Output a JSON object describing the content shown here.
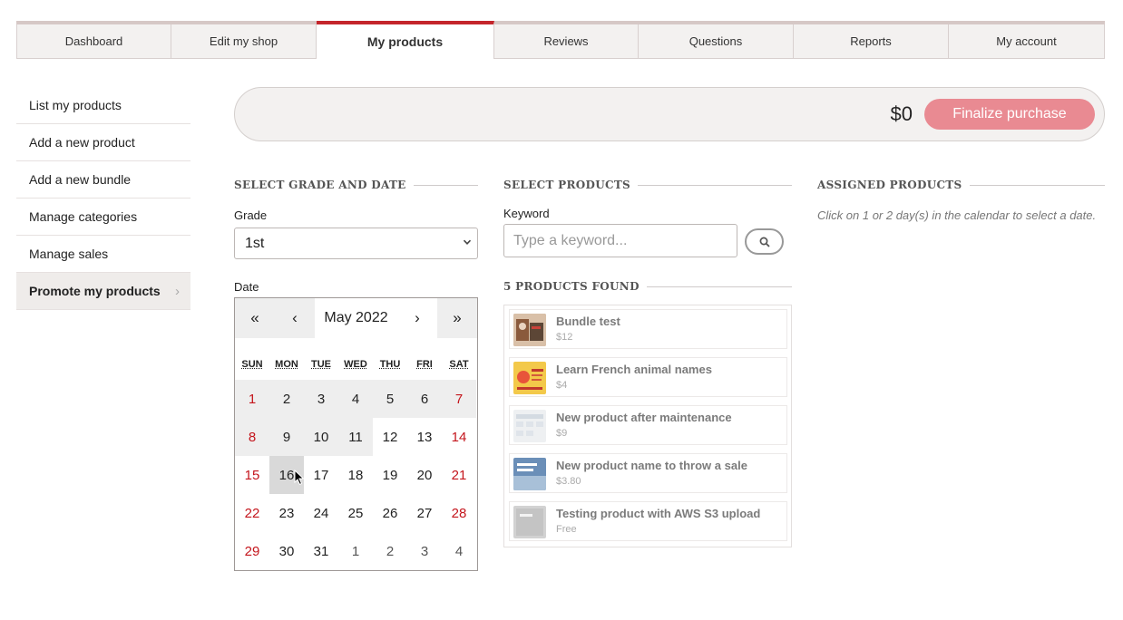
{
  "tabs": [
    {
      "label": "Dashboard"
    },
    {
      "label": "Edit my shop"
    },
    {
      "label": "My products",
      "active": true
    },
    {
      "label": "Reviews"
    },
    {
      "label": "Questions"
    },
    {
      "label": "Reports"
    },
    {
      "label": "My account"
    }
  ],
  "sidebar": {
    "items": [
      {
        "label": "List my products"
      },
      {
        "label": "Add a new product"
      },
      {
        "label": "Add a new bundle"
      },
      {
        "label": "Manage categories"
      },
      {
        "label": "Manage sales"
      },
      {
        "label": "Promote my products",
        "active": true,
        "chevron": "›"
      }
    ]
  },
  "purchase": {
    "total": "$0",
    "button": "Finalize purchase"
  },
  "grade_date": {
    "heading": "SELECT GRADE AND DATE",
    "grade_label": "Grade",
    "grade_value": "1st",
    "date_label": "Date"
  },
  "calendar": {
    "prev_year": "«",
    "prev_month": "‹",
    "month": "May 2022",
    "next_month": "›",
    "next_year": "»",
    "days_of_week": [
      "SUN",
      "MON",
      "TUE",
      "WED",
      "THU",
      "FRI",
      "SAT"
    ],
    "weeks": [
      [
        "1",
        "2",
        "3",
        "4",
        "5",
        "6",
        "7"
      ],
      [
        "8",
        "9",
        "10",
        "11",
        "12",
        "13",
        "14"
      ],
      [
        "15",
        "16",
        "17",
        "18",
        "19",
        "20",
        "21"
      ],
      [
        "22",
        "23",
        "24",
        "25",
        "26",
        "27",
        "28"
      ],
      [
        "29",
        "30",
        "31",
        "1",
        "2",
        "3",
        "4"
      ]
    ],
    "weekend_color": "#c4151c",
    "hovered_day": "16"
  },
  "products": {
    "heading": "SELECT PRODUCTS",
    "keyword_label": "Keyword",
    "keyword_placeholder": "Type a keyword...",
    "found_heading": "5 PRODUCTS FOUND",
    "items": [
      {
        "name": "Bundle test",
        "price": "$12"
      },
      {
        "name": "Learn French animal names",
        "price": "$4"
      },
      {
        "name": "New product after maintenance",
        "price": "$9"
      },
      {
        "name": "New product name to throw a sale",
        "price": "$3.80"
      },
      {
        "name": "Testing product with AWS S3 upload",
        "price": "Free"
      }
    ]
  },
  "assigned": {
    "heading": "ASSIGNED PRODUCTS",
    "note": "Click on 1 or 2 day(s) in the calendar to select a date."
  },
  "colors": {
    "accent": "#c4252b",
    "finalize_button": "#e98a92"
  }
}
